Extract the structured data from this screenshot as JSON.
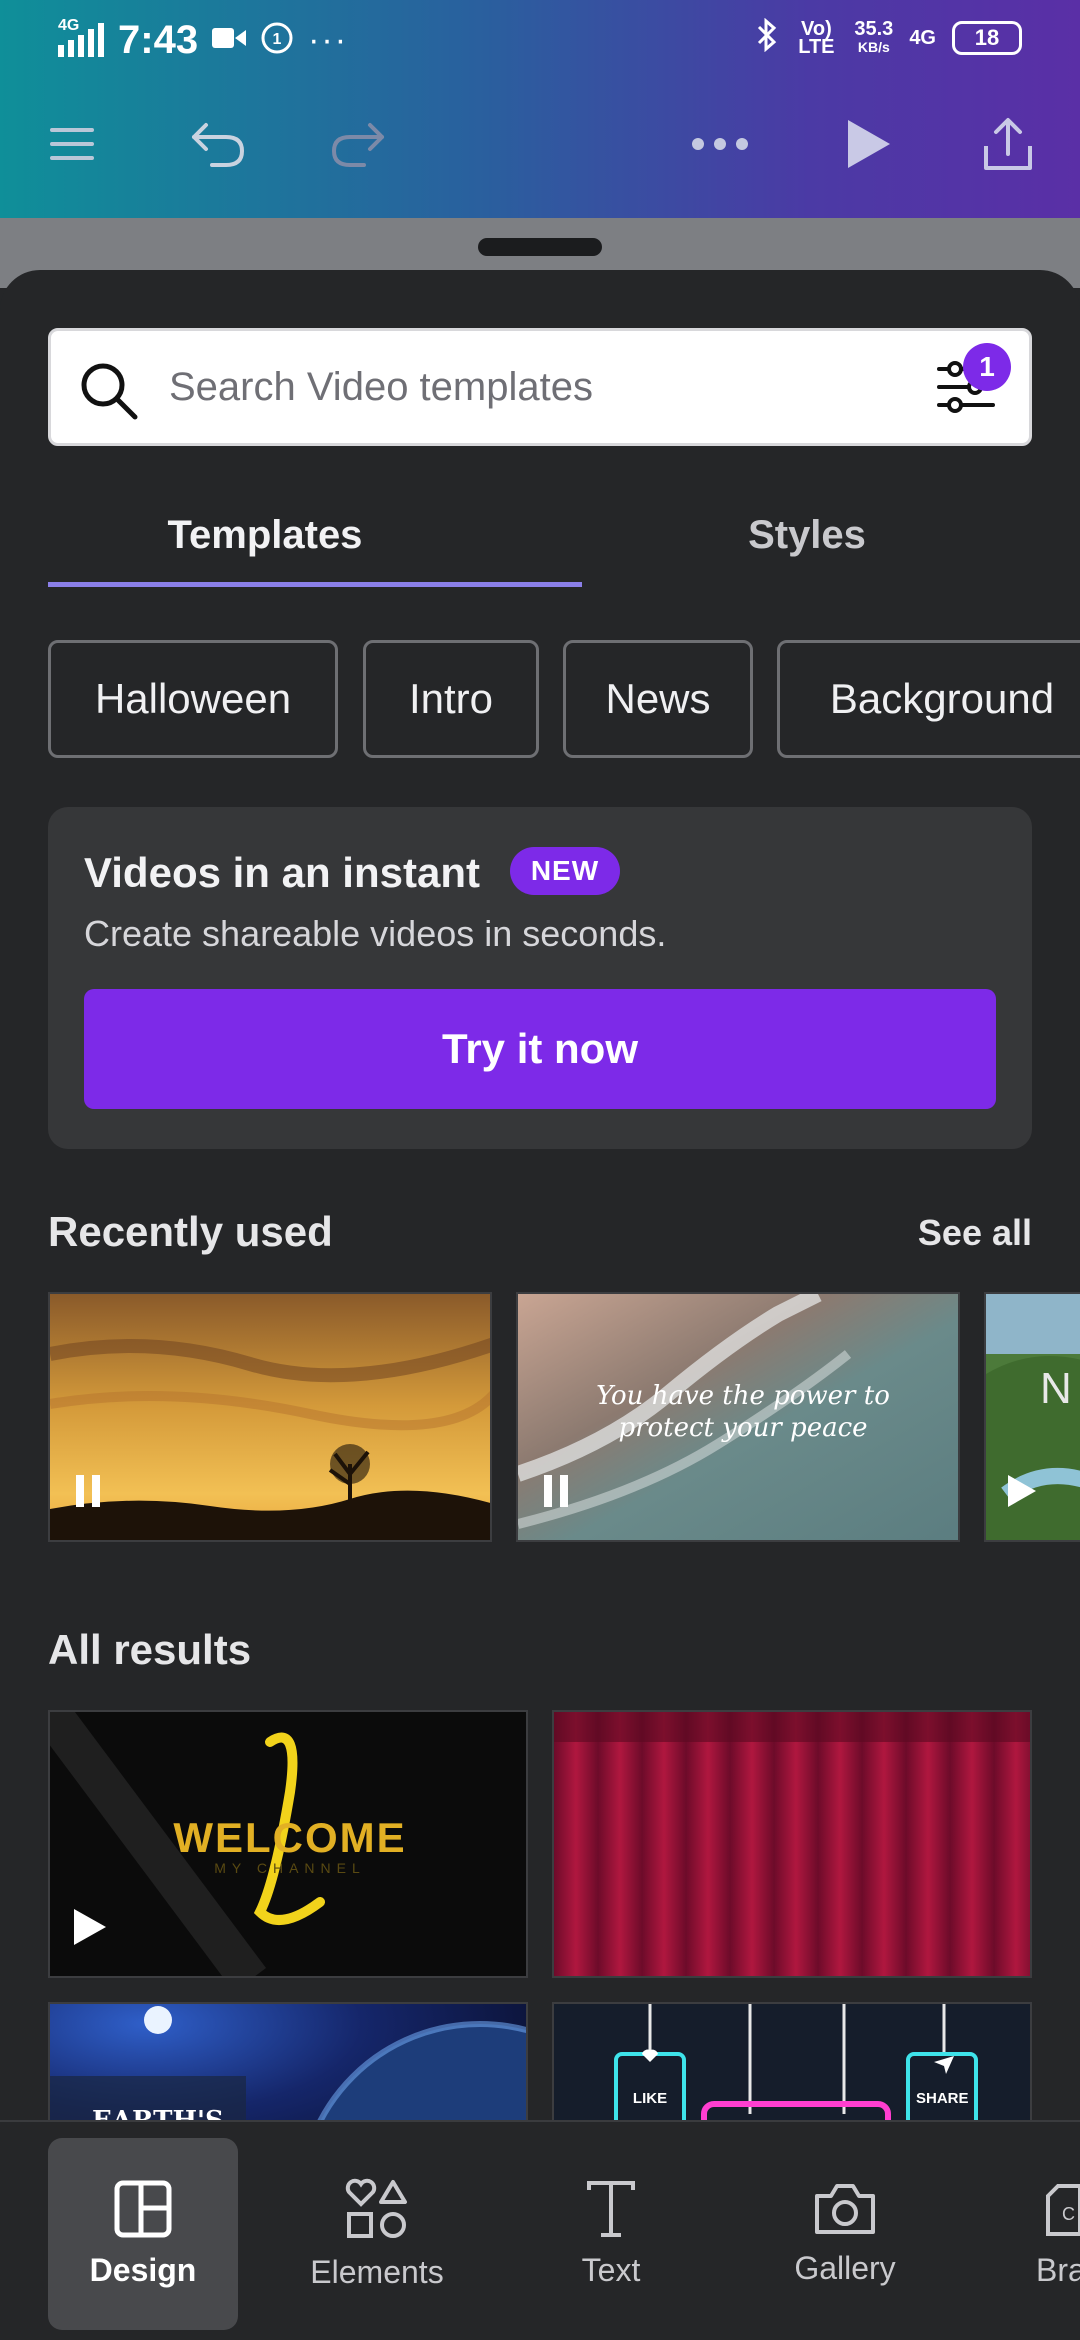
{
  "status_bar": {
    "network_left": "4G",
    "time": "7:43",
    "volte": "Vo) LTE",
    "speed": "35.3",
    "speed_unit": "KB/s",
    "network_right": "4G",
    "battery": "18"
  },
  "toolbar": {
    "icons": [
      "menu-icon",
      "undo-icon",
      "redo-icon",
      "more-icon",
      "play-icon",
      "share-icon"
    ]
  },
  "search": {
    "placeholder": "Search Video templates",
    "filter_badge": "1"
  },
  "tabs": [
    "Templates",
    "Styles"
  ],
  "chips": [
    "Halloween",
    "Intro",
    "News",
    "Background"
  ],
  "promo": {
    "title": "Videos in an instant",
    "badge": "NEW",
    "subtitle": "Create shareable videos in seconds.",
    "button": "Try it now"
  },
  "recently_used": {
    "title": "Recently used",
    "see_all": "See all",
    "items": [
      {
        "text": ""
      },
      {
        "text": "You have the power to protect your peace"
      },
      {
        "text": "N"
      }
    ]
  },
  "all_results": {
    "title": "All results",
    "items": [
      {
        "text": "WELCOME",
        "subtext": "MY CHANNEL"
      },
      {
        "text": ""
      },
      {
        "text": "EARTH'S"
      },
      {
        "text_left": "LIKE",
        "text_right": "SHARE"
      }
    ]
  },
  "bottom_nav": [
    "Design",
    "Elements",
    "Text",
    "Gallery",
    "Bra"
  ],
  "colors": {
    "accent": "#7d2ae8",
    "background": "#252628",
    "card": "#363739"
  }
}
